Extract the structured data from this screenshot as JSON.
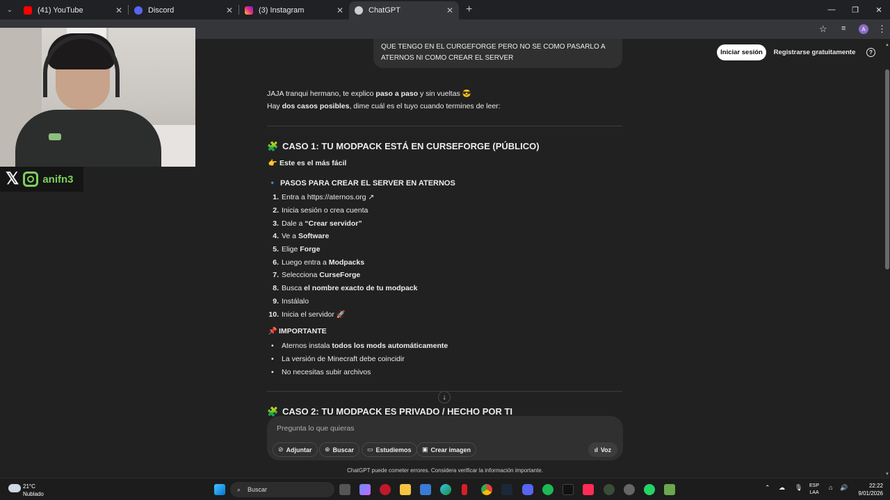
{
  "browser": {
    "tabs": [
      {
        "title": "(41) YouTube",
        "favicon_color": "#ff0000",
        "active": false
      },
      {
        "title": "Discord",
        "favicon_color": "#5865f2",
        "active": false
      },
      {
        "title": "(3) Instagram",
        "favicon_color": "#e1306c",
        "active": false
      },
      {
        "title": "ChatGPT",
        "favicon_color": "#cfcfcf",
        "active": true
      }
    ],
    "new_tab_label": "+",
    "profile_initial": "A"
  },
  "overlay": {
    "social_handle": "anifn3"
  },
  "header": {
    "login_label": "Iniciar sesión",
    "register_label": "Registrarse gratuitamente",
    "help_icon": "?"
  },
  "user_message": {
    "line1": "QUE TENGO EN EL CURGEFORGE PERO NO SE COMO PASARLO A",
    "line2": "ATERNOS NI COMO CREAR EL SERVER"
  },
  "response": {
    "intro1_a": "JAJA tranqui hermano, te explico ",
    "intro1_b": "paso a paso",
    "intro1_c": " y sin vueltas ",
    "intro1_emoji": "😎",
    "intro2_a": "Hay ",
    "intro2_b": "dos casos posibles",
    "intro2_c": ", dime cuál es el tuyo cuando termines de leer:",
    "case1_title": "CASO 1: TU MODPACK ESTÁ EN CURSEFORGE (PÚBLICO)",
    "case1_emoji": "🧩",
    "easy_emoji": "👉",
    "easy_text": "Este es el más fácil",
    "steps_emoji": "🔹",
    "steps_title": "PASOS PARA CREAR EL SERVER EN ATERNOS",
    "steps": [
      {
        "num": "1.",
        "a": "Entra a ",
        "b": "",
        "link": "https://aternos.org ↗"
      },
      {
        "num": "2.",
        "a": "Inicia sesión o crea cuenta",
        "b": "",
        "link": ""
      },
      {
        "num": "3.",
        "a": "Dale a ",
        "b": "“Crear servidor”",
        "link": ""
      },
      {
        "num": "4.",
        "a": "Ve a ",
        "b": "Software",
        "link": ""
      },
      {
        "num": "5.",
        "a": "Elige ",
        "b": "Forge",
        "link": ""
      },
      {
        "num": "6.",
        "a": "Luego entra a ",
        "b": "Modpacks",
        "link": ""
      },
      {
        "num": "7.",
        "a": "Selecciona ",
        "b": "CurseForge",
        "link": ""
      },
      {
        "num": "8.",
        "a": "Busca ",
        "b": "el nombre exacto de tu modpack",
        "link": ""
      },
      {
        "num": "9.",
        "a": "Instálalo",
        "b": "",
        "link": ""
      },
      {
        "num": "10.",
        "a": "Inicia el servidor ",
        "b": "🚀",
        "link": ""
      }
    ],
    "important_emoji": "📌",
    "important_title": "IMPORTANTE",
    "bullets": [
      {
        "a": "Aternos instala ",
        "b": "todos los mods automáticamente"
      },
      {
        "a": "La versión de Minecraft debe coincidir",
        "b": ""
      },
      {
        "a": "No necesitas subir archivos",
        "b": ""
      }
    ],
    "case2_emoji": "🧩",
    "case2_title": "CASO 2: TU MODPACK ES PRIVADO / HECHO POR TI"
  },
  "composer": {
    "placeholder": "Pregunta lo que quieras",
    "attach_label": "Adjuntar",
    "search_label": "Buscar",
    "study_label": "Estudiemos",
    "image_label": "Crear imagen",
    "voice_label": "Voz",
    "disclaimer": "ChatGPT puede cometer errores. Considera verificar la información importante."
  },
  "taskbar": {
    "weather_temp": "21°C",
    "weather_desc": "Nublado",
    "search_label": "Buscar",
    "lang1": "ESP",
    "lang2": "LAA",
    "time": "22:22",
    "date": "9/01/2026"
  }
}
